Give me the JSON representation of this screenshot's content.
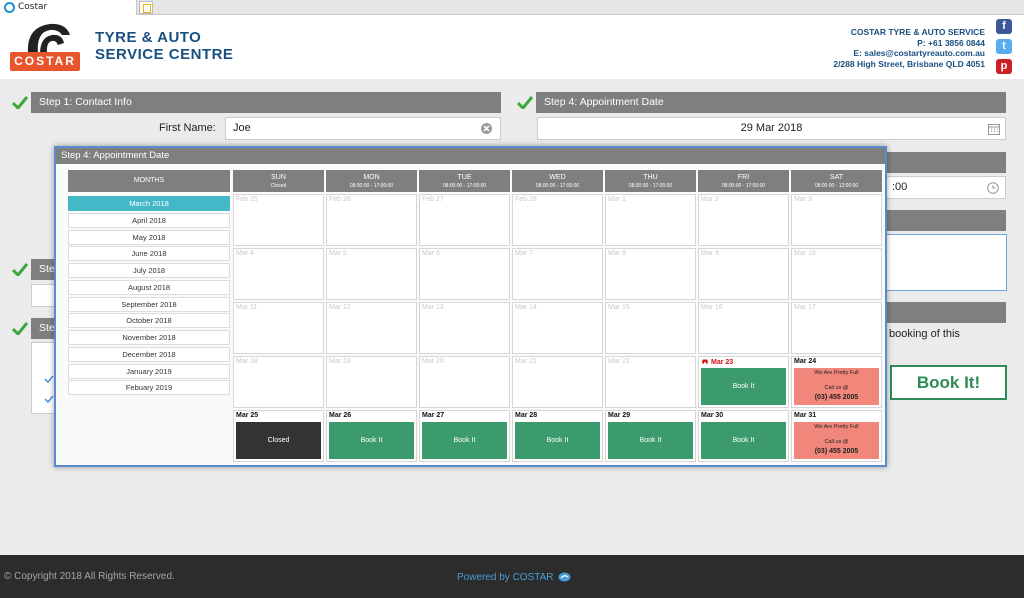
{
  "browser": {
    "tab_title": "Costar"
  },
  "header": {
    "logo_text": "COSTAR",
    "brand_line1": "TYRE & AUTO",
    "brand_line2": "SERVICE CENTRE",
    "contact": [
      "COSTAR TYRE & AUTO SERVICE",
      "P: +61 3856 0844",
      "E: sales@costartyreauto.com.au",
      "2/288 High Street, Brisbane QLD 4051"
    ],
    "social": [
      "facebook-icon",
      "twitter-icon",
      "pinterest-icon"
    ]
  },
  "form": {
    "step1_title": "Step 1: Contact Info",
    "first_name_label": "First Name:",
    "first_name_value": "Joe",
    "step4_title": "Step 4: Appointment Date",
    "date_value": "29 Mar 2018",
    "time_partial": ":00",
    "step_partial": "Ste",
    "booking_partial": "booking of this",
    "book_button": "Book It!"
  },
  "modal": {
    "title": "Step 4: Appointment Date",
    "months_header": "MONTHS",
    "months": [
      "March 2018",
      "April 2018",
      "May 2018",
      "June 2018",
      "July 2018",
      "August 2018",
      "September 2018",
      "October 2018",
      "November 2018",
      "December 2018",
      "January 2019",
      "Febuary 2019"
    ],
    "active_month": 0,
    "days": [
      {
        "name": "SUN",
        "hours": "Closed"
      },
      {
        "name": "MON",
        "hours": "08:00:00 - 17:00:00"
      },
      {
        "name": "TUE",
        "hours": "08:00:00 - 17:00:00"
      },
      {
        "name": "WED",
        "hours": "08:00:00 - 17:00:00"
      },
      {
        "name": "THU",
        "hours": "08:00:00 - 17:00:00"
      },
      {
        "name": "FRI",
        "hours": "08:00:00 - 17:00:00"
      },
      {
        "name": "SAT",
        "hours": "08:00:00 - 12:00:00"
      }
    ],
    "weeks": [
      [
        {
          "d": "Feb 25",
          "s": "past"
        },
        {
          "d": "Feb 26",
          "s": "past"
        },
        {
          "d": "Feb 27",
          "s": "past"
        },
        {
          "d": "Feb 28",
          "s": "past"
        },
        {
          "d": "Mar 1",
          "s": "past"
        },
        {
          "d": "Mar 2",
          "s": "past"
        },
        {
          "d": "Mar 3",
          "s": "past"
        }
      ],
      [
        {
          "d": "Mar 4",
          "s": "past"
        },
        {
          "d": "Mar 5",
          "s": "past"
        },
        {
          "d": "Mar 6",
          "s": "past"
        },
        {
          "d": "Mar 7",
          "s": "past"
        },
        {
          "d": "Mar 8",
          "s": "past"
        },
        {
          "d": "Mar 9",
          "s": "past"
        },
        {
          "d": "Mar 10",
          "s": "past"
        }
      ],
      [
        {
          "d": "Mar 11",
          "s": "past"
        },
        {
          "d": "Mar 12",
          "s": "past"
        },
        {
          "d": "Mar 13",
          "s": "past"
        },
        {
          "d": "Mar 14",
          "s": "past"
        },
        {
          "d": "Mar 15",
          "s": "past"
        },
        {
          "d": "Mar 16",
          "s": "past"
        },
        {
          "d": "Mar 17",
          "s": "past"
        }
      ],
      [
        {
          "d": "Mar 18",
          "s": "past"
        },
        {
          "d": "Mar 19",
          "s": "past"
        },
        {
          "d": "Mar 20",
          "s": "past"
        },
        {
          "d": "Mar 21",
          "s": "past"
        },
        {
          "d": "Mar 22",
          "s": "past"
        },
        {
          "d": "Mar 23",
          "s": "today-book"
        },
        {
          "d": "Mar 24",
          "s": "full"
        }
      ],
      [
        {
          "d": "Mar 25",
          "s": "closed"
        },
        {
          "d": "Mar 26",
          "s": "book"
        },
        {
          "d": "Mar 27",
          "s": "book"
        },
        {
          "d": "Mar 28",
          "s": "book"
        },
        {
          "d": "Mar 29",
          "s": "book"
        },
        {
          "d": "Mar 30",
          "s": "book"
        },
        {
          "d": "Mar 31",
          "s": "full"
        }
      ]
    ],
    "book_label": "Book It",
    "closed_label": "Closed",
    "full_label": "We Are Pretty Full",
    "call_label": "Call us @",
    "phone": "(03) 455 2005"
  },
  "footer": {
    "copyright": "© Copyright 2018 All Rights Reserved.",
    "powered": "Powered by COSTAR"
  },
  "colors": {
    "brand_blue": "#1a4f82",
    "logo_orange": "#e8552a",
    "accent_teal": "#45b8c7",
    "book_green": "#3b9b6d",
    "full_salmon": "#f0877a",
    "check_green": "#3aa83a",
    "modal_border": "#5b8bcf"
  }
}
